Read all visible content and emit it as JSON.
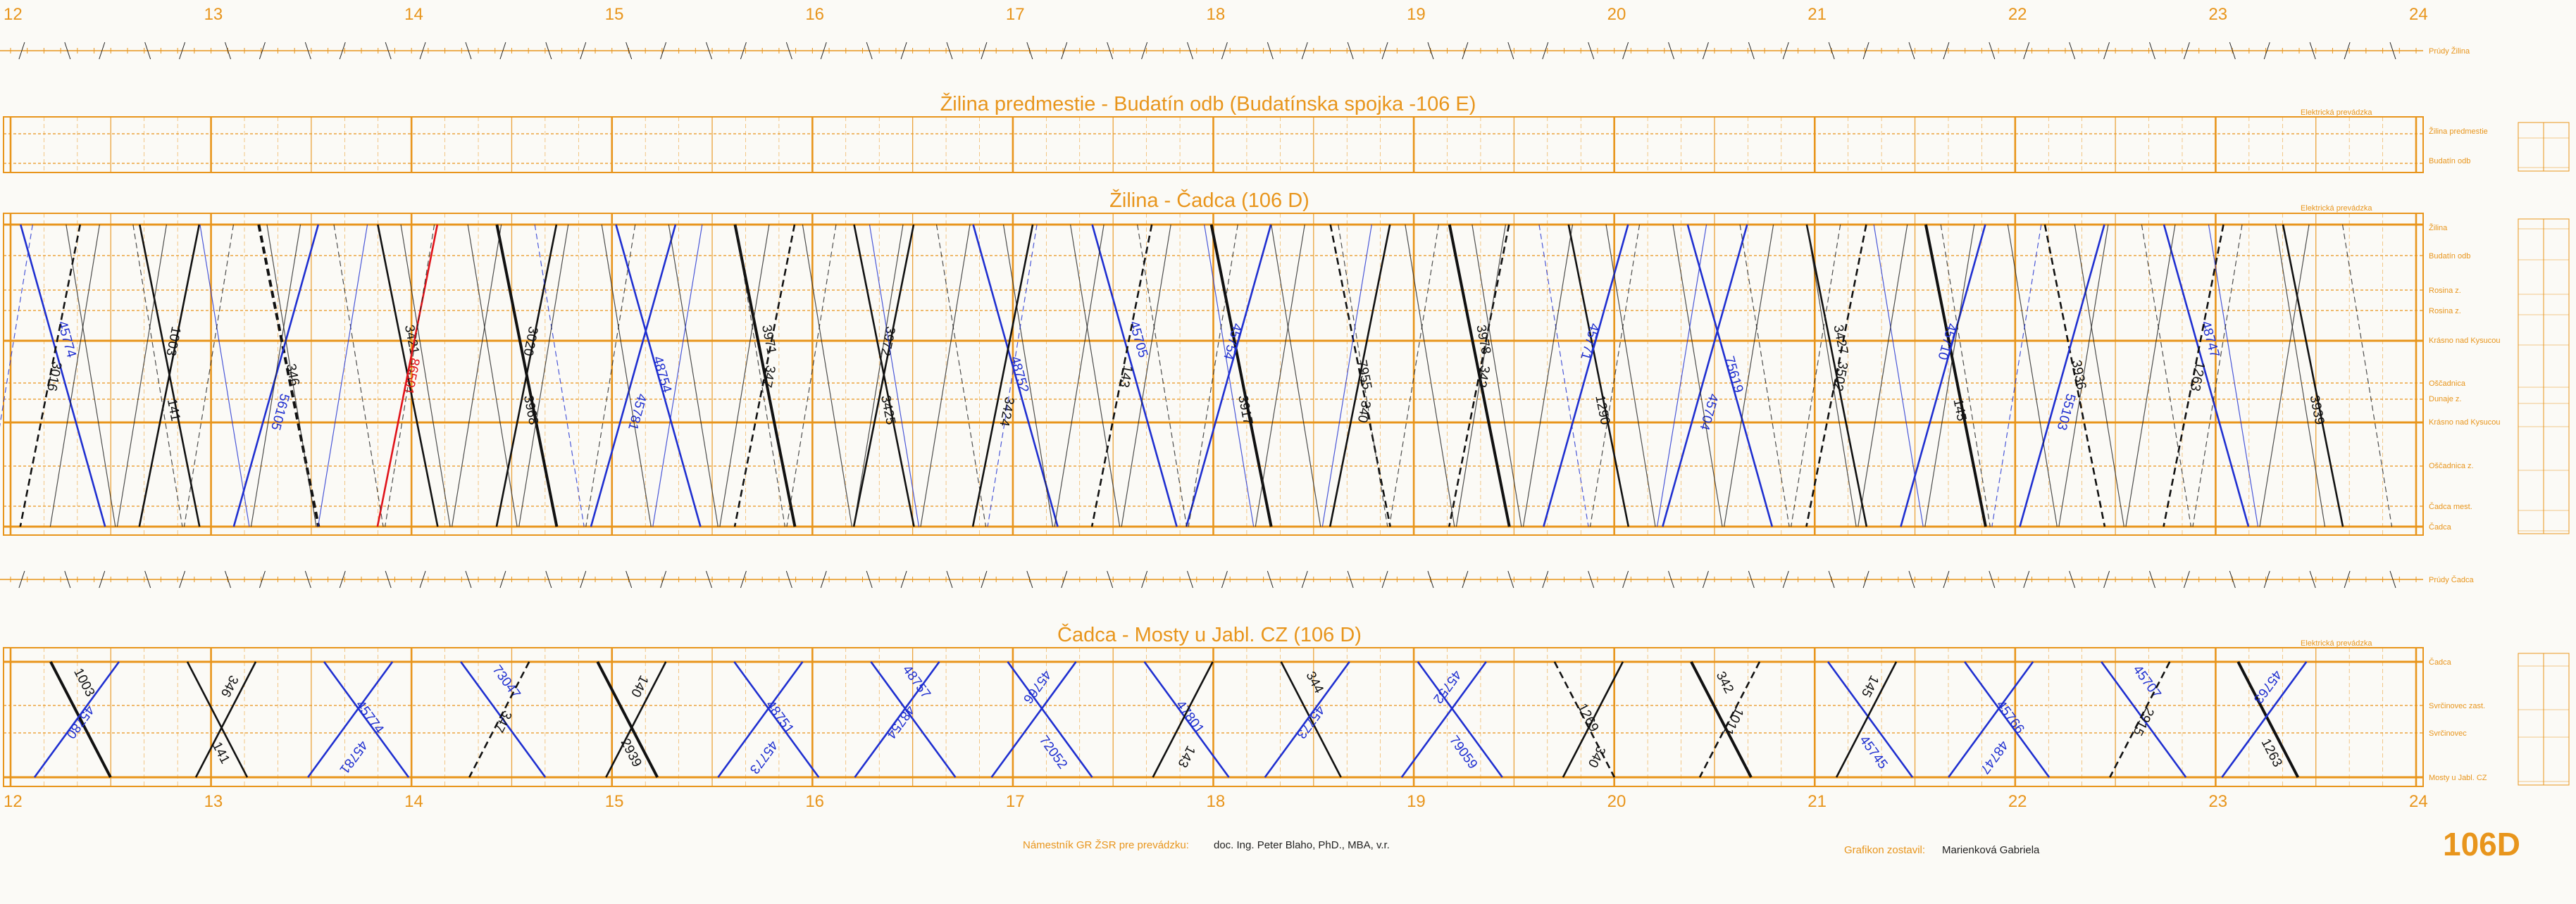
{
  "hours": [
    "12",
    "13",
    "14",
    "15",
    "16",
    "17",
    "18",
    "19",
    "20",
    "21",
    "22",
    "23",
    "24"
  ],
  "colors": {
    "grid": "#e8951c",
    "passenger": "#111111",
    "freight": "#1f2fd0",
    "special": "#e0131a"
  },
  "strips": {
    "top": "Prúdy Žilina",
    "middle": "Prúdy Čadca"
  },
  "electric_label": "Elektrická prevádzka",
  "sections": [
    {
      "title": "Žilina predmestie - Budatín odb (Budatínska spojka -106 E)",
      "stations": [
        "Žilina predmestie",
        "Budatín odb"
      ]
    },
    {
      "title": "Žilina - Čadca (106 D)",
      "stations": [
        "Žilina",
        "Budatín odb",
        "Rosina z.",
        "Rosina z.",
        "Krásno nad Kysucou",
        "Oščadnica",
        "Dunaje z.",
        "Krásno nad Kysucou",
        "Oščadnica z.",
        "Čadca mest.",
        "Čadca"
      ],
      "trains": [
        {
          "label": "45774",
          "color": "freight"
        },
        {
          "label": "3016",
          "color": "passenger"
        },
        {
          "label": "141",
          "color": "passenger"
        },
        {
          "label": "1003",
          "color": "passenger"
        },
        {
          "label": "346",
          "color": "passenger"
        },
        {
          "label": "56105",
          "color": "freight"
        },
        {
          "label": "3421",
          "color": "passenger"
        },
        {
          "label": "86501",
          "color": "special"
        },
        {
          "label": "3968",
          "color": "passenger"
        },
        {
          "label": "3020",
          "color": "passenger"
        },
        {
          "label": "48754",
          "color": "freight"
        },
        {
          "label": "45781",
          "color": "freight"
        },
        {
          "label": "3971",
          "color": "passenger"
        },
        {
          "label": "347",
          "color": "passenger"
        },
        {
          "label": "3425",
          "color": "passenger"
        },
        {
          "label": "3972",
          "color": "passenger"
        },
        {
          "label": "48752",
          "color": "freight"
        },
        {
          "label": "3424",
          "color": "passenger"
        },
        {
          "label": "45705",
          "color": "freight"
        },
        {
          "label": "143",
          "color": "passenger"
        },
        {
          "label": "3917",
          "color": "passenger"
        },
        {
          "label": "45754",
          "color": "freight"
        },
        {
          "label": "7955",
          "color": "passenger"
        },
        {
          "label": "340",
          "color": "passenger"
        },
        {
          "label": "3978",
          "color": "passenger"
        },
        {
          "label": "342",
          "color": "passenger"
        },
        {
          "label": "1290",
          "color": "passenger"
        },
        {
          "label": "45771",
          "color": "freight"
        },
        {
          "label": "75619",
          "color": "freight"
        },
        {
          "label": "45704",
          "color": "freight"
        },
        {
          "label": "3427",
          "color": "passenger"
        },
        {
          "label": "3502",
          "color": "passenger"
        },
        {
          "label": "145",
          "color": "passenger"
        },
        {
          "label": "45710",
          "color": "freight"
        },
        {
          "label": "3936",
          "color": "passenger"
        },
        {
          "label": "55103",
          "color": "freight"
        },
        {
          "label": "48747",
          "color": "freight"
        },
        {
          "label": "1263",
          "color": "passenger"
        },
        {
          "label": "3939",
          "color": "passenger"
        }
      ]
    },
    {
      "title": "Čadca - Mosty u Jabl. CZ (106 D)",
      "stations": [
        "Čadca",
        "Svrčinovec zast.",
        "Svrčinovec",
        "Mosty u Jabl. CZ"
      ],
      "trains": [
        {
          "label": "1003",
          "color": "passenger"
        },
        {
          "label": "45780",
          "color": "freight"
        },
        {
          "label": "141",
          "color": "passenger"
        },
        {
          "label": "346",
          "color": "passenger"
        },
        {
          "label": "45774",
          "color": "freight"
        },
        {
          "label": "45781",
          "color": "freight"
        },
        {
          "label": "73047",
          "color": "freight"
        },
        {
          "label": "347",
          "color": "passenger"
        },
        {
          "label": "2939",
          "color": "passenger"
        },
        {
          "label": "140",
          "color": "passenger"
        },
        {
          "label": "48751",
          "color": "freight"
        },
        {
          "label": "45773",
          "color": "freight"
        },
        {
          "label": "48757",
          "color": "freight"
        },
        {
          "label": "48754",
          "color": "freight"
        },
        {
          "label": "72052",
          "color": "freight"
        },
        {
          "label": "45766",
          "color": "freight"
        },
        {
          "label": "47801",
          "color": "freight"
        },
        {
          "label": "143",
          "color": "passenger"
        },
        {
          "label": "344",
          "color": "passenger"
        },
        {
          "label": "45773",
          "color": "freight"
        },
        {
          "label": "79059",
          "color": "freight"
        },
        {
          "label": "45752",
          "color": "freight"
        },
        {
          "label": "1269",
          "color": "passenger"
        },
        {
          "label": "340",
          "color": "passenger"
        },
        {
          "label": "342",
          "color": "passenger"
        },
        {
          "label": "1011",
          "color": "passenger"
        },
        {
          "label": "45745",
          "color": "freight"
        },
        {
          "label": "145",
          "color": "passenger"
        },
        {
          "label": "45766",
          "color": "freight"
        },
        {
          "label": "48747",
          "color": "freight"
        },
        {
          "label": "45707",
          "color": "freight"
        },
        {
          "label": "2915",
          "color": "passenger"
        },
        {
          "label": "1263",
          "color": "passenger"
        },
        {
          "label": "45763",
          "color": "freight"
        }
      ]
    }
  ],
  "footer": {
    "deputy_label": "Námestník GR ŽSR pre prevádzku:",
    "deputy_name": "doc. Ing. Peter Blaho, PhD., MBA, v.r.",
    "author_label": "Grafikon zostavil:",
    "author_name": "Marienková Gabriela",
    "code": "106D"
  }
}
